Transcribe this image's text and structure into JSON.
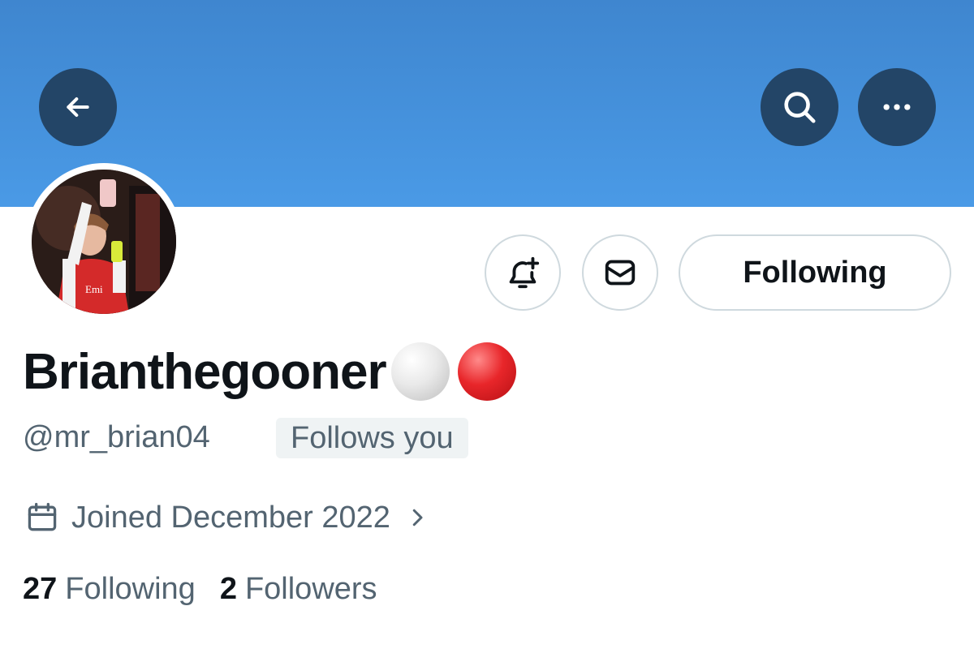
{
  "header": {
    "banner_color": "#4a9ae6",
    "button_color": "#234567",
    "back_icon": "arrow-left-icon",
    "search_icon": "search-icon",
    "more_icon": "more-horizontal-icon"
  },
  "profile": {
    "display_name": "Brianthegooner",
    "name_emojis": [
      "white-circle",
      "red-circle"
    ],
    "handle": "@mr_brian04",
    "follows_badge": "Follows you",
    "joined": "Joined December 2022",
    "following_count": "27",
    "following_label": "Following",
    "followers_count": "2",
    "followers_label": "Followers"
  },
  "actions": {
    "notify_icon": "bell-plus-icon",
    "message_icon": "envelope-icon",
    "follow_state_label": "Following"
  }
}
